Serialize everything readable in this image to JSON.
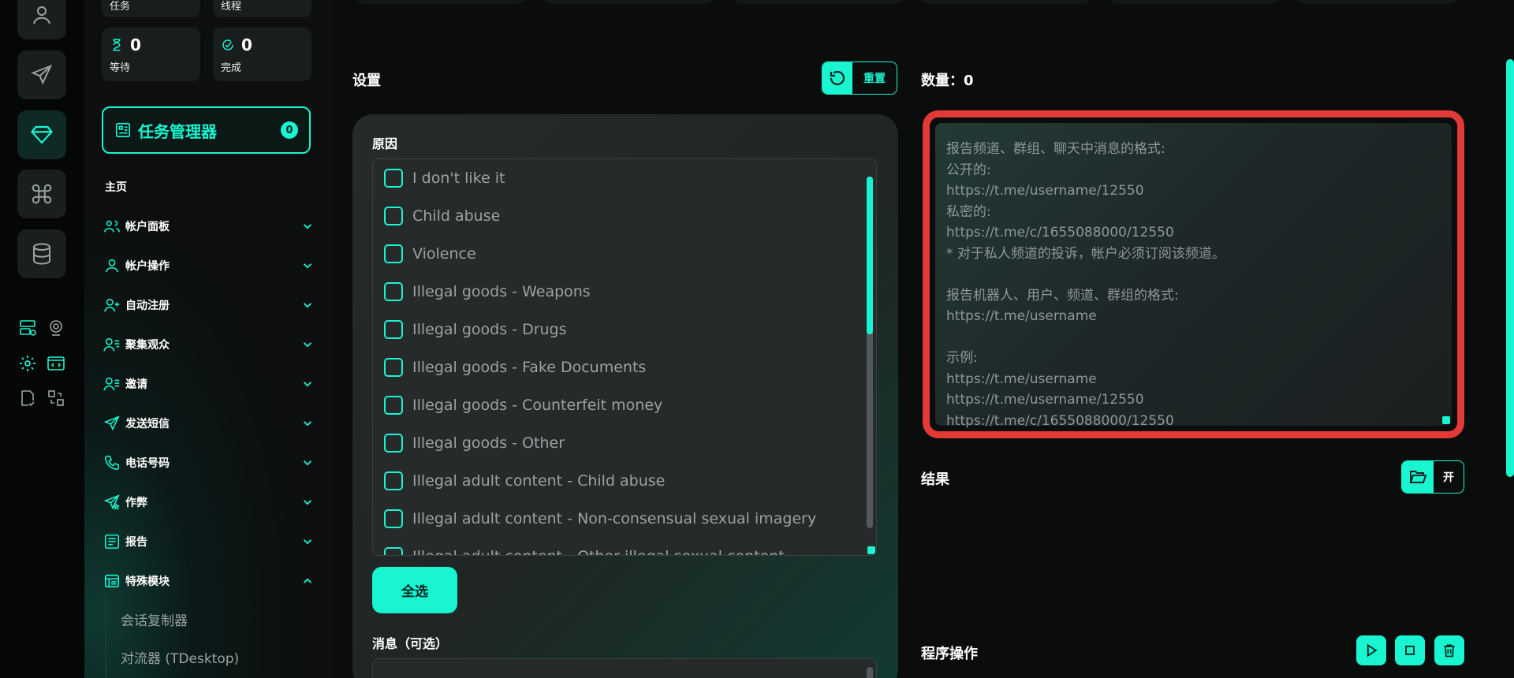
{
  "sidebar": {
    "top_stats": [
      {
        "label": "任务"
      },
      {
        "label": "线程"
      }
    ],
    "stats": [
      {
        "value": "0",
        "label": "等待",
        "icon": "hourglass-icon"
      },
      {
        "value": "0",
        "label": "完成",
        "icon": "check-circle-icon"
      }
    ],
    "task_manager": {
      "label": "任务管理器",
      "count": "0"
    },
    "home_label": "主页",
    "nav": [
      {
        "label": "帐户面板",
        "icon": "users-icon",
        "expanded": false
      },
      {
        "label": "帐户操作",
        "icon": "user-icon",
        "expanded": false
      },
      {
        "label": "自动注册",
        "icon": "user-plus-icon",
        "expanded": false
      },
      {
        "label": "聚集观众",
        "icon": "user-list-icon",
        "expanded": false
      },
      {
        "label": "邀请",
        "icon": "user-invite-icon",
        "expanded": false
      },
      {
        "label": "发送短信",
        "icon": "send-icon",
        "expanded": false
      },
      {
        "label": "电话号码",
        "icon": "phone-icon",
        "expanded": false
      },
      {
        "label": "作弊",
        "icon": "send-star-icon",
        "expanded": false
      },
      {
        "label": "报告",
        "icon": "report-icon",
        "expanded": false
      },
      {
        "label": "特殊模块",
        "icon": "module-icon",
        "expanded": true
      }
    ],
    "sub_items": [
      "会话复制器",
      "对流器 (TDesktop)"
    ]
  },
  "settings": {
    "title": "设置",
    "reset_label": "重置",
    "reason_label": "原因",
    "reasons": [
      "I don't like it",
      "Child abuse",
      "Violence",
      "Illegal goods - Weapons",
      "Illegal goods - Drugs",
      "Illegal goods - Fake Documents",
      "Illegal goods - Counterfeit money",
      "Illegal goods - Other",
      "Illegal adult content - Child abuse",
      "Illegal adult content - Non-consensual sexual imagery",
      "Illegal adult content - Other illegal sexual content"
    ],
    "select_all_label": "全选",
    "message_label": "消息（可选）"
  },
  "links": {
    "count_title": "数量：0",
    "placeholder_lines": [
      "报告频道、群组、聊天中消息的格式:",
      "公开的:",
      "https://t.me/username/12550",
      "私密的:",
      "https://t.me/c/1655088000/12550",
      "* 对于私人频道的投诉，帐户必须订阅该频道。",
      "",
      "报告机器人、用户、频道、群组的格式:",
      "https://t.me/username",
      "",
      "示例:",
      "https://t.me/username",
      "https://t.me/username/12550",
      "https://t.me/c/1655088000/12550"
    ]
  },
  "results": {
    "title": "结果",
    "open_label": "开"
  },
  "operations": {
    "title": "程序操作"
  },
  "colors": {
    "accent": "#19f5d0",
    "highlight_border": "#e23a36"
  }
}
